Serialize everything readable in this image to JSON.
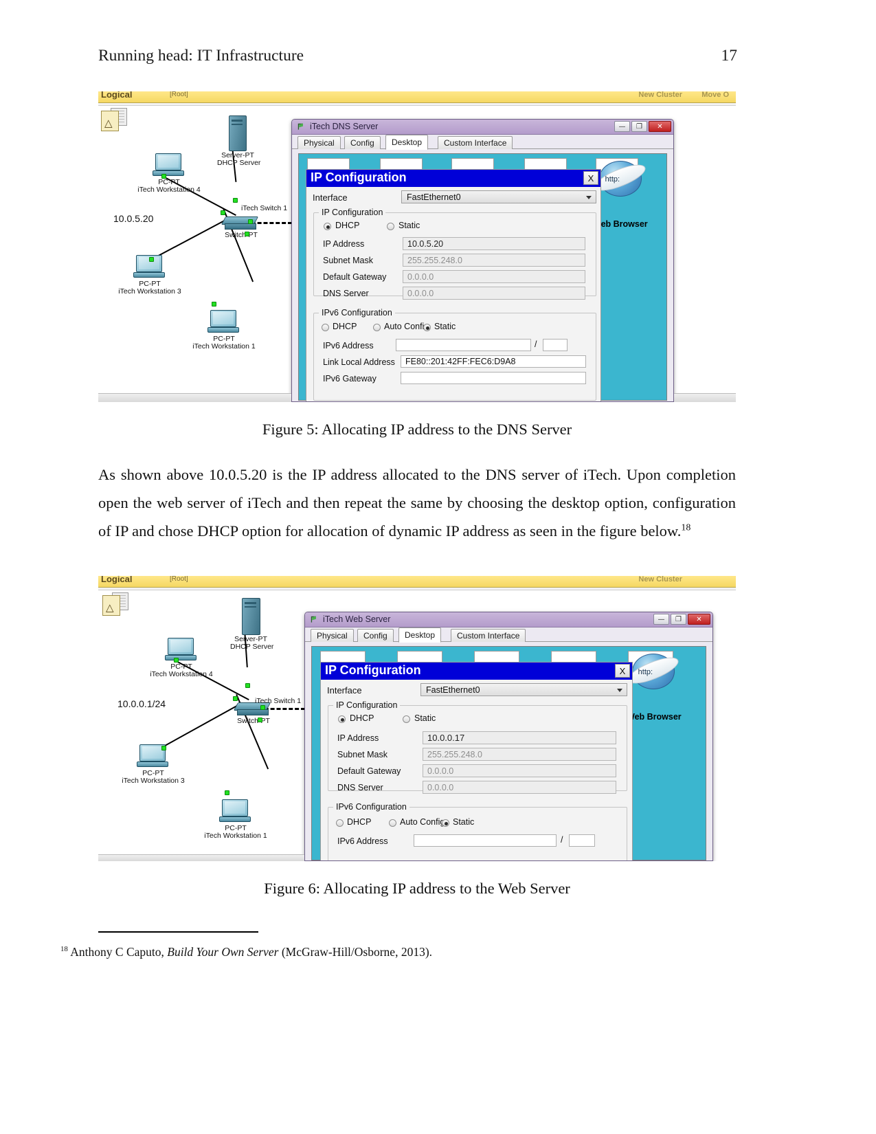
{
  "header": {
    "running_head": "Running head: IT Infrastructure",
    "page_number": "17"
  },
  "body": {
    "paragraph": "As shown above 10.0.5.20 is the IP address allocated to the DNS server of iTech. Upon completion open the web server of iTech and then repeat the same by choosing the desktop option, configuration of IP and chose DHCP option for allocation of dynamic IP address as seen in the figure below.",
    "footnote_marker": "18"
  },
  "figure5": {
    "caption": "Figure 5: Allocating IP address to the DNS Server",
    "packet_tracer": {
      "tab_label": "Logical",
      "root_label": "[Root]",
      "new_cluster": "New Cluster",
      "move_object": "Move O",
      "ip_label": "10.0.5.20",
      "devices": [
        {
          "model": "Server-PT",
          "name": "DHCP Server"
        },
        {
          "model": "PC-PT",
          "name": "iTech Workstation 4"
        },
        {
          "model": "PC-PT",
          "name": "iTech Workstation 3"
        },
        {
          "model": "PC-PT",
          "name": "iTech Workstation 1"
        },
        {
          "model": "Switch-PT",
          "name": "iTech Switch 1"
        }
      ]
    },
    "window": {
      "title": "iTech DNS Server",
      "tabs": [
        "Physical",
        "Config",
        "Desktop",
        "Custom Interface"
      ],
      "active_tab": "Desktop",
      "buttons": {
        "minimize": "—",
        "maximize": "❐",
        "close": "✕"
      },
      "web_browser_label": "Web Browser",
      "browser_icon_text": "http:"
    },
    "ip_configuration": {
      "title": "IP Configuration",
      "close_label": "X",
      "interface_label": "Interface",
      "interface_value": "FastEthernet0",
      "ipv4_group": "IP Configuration",
      "dhcp_label": "DHCP",
      "static_label": "Static",
      "ipv4_mode": "DHCP",
      "fields": [
        {
          "label": "IP Address",
          "value": "10.0.5.20"
        },
        {
          "label": "Subnet Mask",
          "value": "255.255.248.0"
        },
        {
          "label": "Default Gateway",
          "value": "0.0.0.0"
        },
        {
          "label": "DNS Server",
          "value": "0.0.0.0"
        }
      ],
      "ipv6_group": "IPv6 Configuration",
      "ipv6_dhcp_label": "DHCP",
      "ipv6_auto_label": "Auto Config",
      "ipv6_static_label": "Static",
      "ipv6_mode": "Static",
      "ipv6_address_label": "IPv6 Address",
      "ipv6_address_value": "",
      "prefix_separator": "/",
      "prefix_value": "",
      "link_local_label": "Link Local Address",
      "link_local_value": "FE80::201:42FF:FEC6:D9A8",
      "ipv6_gateway_label": "IPv6 Gateway",
      "ipv6_gateway_value": ""
    }
  },
  "figure6": {
    "caption": "Figure 6: Allocating IP address to the Web Server",
    "packet_tracer": {
      "tab_label": "Logical",
      "root_label": "[Root]",
      "new_cluster": "New Cluster",
      "ip_label": "10.0.0.1/24",
      "devices": [
        {
          "model": "Server-PT",
          "name": "DHCP Server"
        },
        {
          "model": "PC-PT",
          "name": "iTech Workstation 4"
        },
        {
          "model": "PC-PT",
          "name": "iTech Workstation 3"
        },
        {
          "model": "PC-PT",
          "name": "iTech Workstation 1"
        },
        {
          "model": "Switch-PT",
          "name": "iTech Switch 1"
        }
      ]
    },
    "window": {
      "title": "iTech Web Server",
      "tabs": [
        "Physical",
        "Config",
        "Desktop",
        "Custom Interface"
      ],
      "active_tab": "Desktop",
      "buttons": {
        "minimize": "—",
        "maximize": "❐",
        "close": "✕"
      },
      "web_browser_label": "Web Browser",
      "browser_icon_text": "http:"
    },
    "ip_configuration": {
      "title": "IP Configuration",
      "close_label": "X",
      "interface_label": "Interface",
      "interface_value": "FastEthernet0",
      "ipv4_group": "IP Configuration",
      "dhcp_label": "DHCP",
      "static_label": "Static",
      "ipv4_mode": "DHCP",
      "fields": [
        {
          "label": "IP Address",
          "value": "10.0.0.17"
        },
        {
          "label": "Subnet Mask",
          "value": "255.255.248.0"
        },
        {
          "label": "Default Gateway",
          "value": "0.0.0.0"
        },
        {
          "label": "DNS Server",
          "value": "0.0.0.0"
        }
      ],
      "ipv6_group": "IPv6 Configuration",
      "ipv6_dhcp_label": "DHCP",
      "ipv6_auto_label": "Auto Config",
      "ipv6_static_label": "Static",
      "ipv6_mode": "Static",
      "ipv6_address_label": "IPv6 Address",
      "ipv6_address_value": "",
      "prefix_separator": "/"
    }
  },
  "footnote": {
    "marker": "18",
    "author": "Anthony C Caputo,",
    "title": "Build Your Own Server",
    "publisher": "(McGraw-Hill/Osborne, 2013)."
  },
  "colors": {
    "yellow_bar": "#f5d863",
    "dialog_title_blue": "#0000d8",
    "desktop_teal": "#3bb6cf",
    "window_purple": "#b49ccb",
    "link_green": "#23e023"
  }
}
